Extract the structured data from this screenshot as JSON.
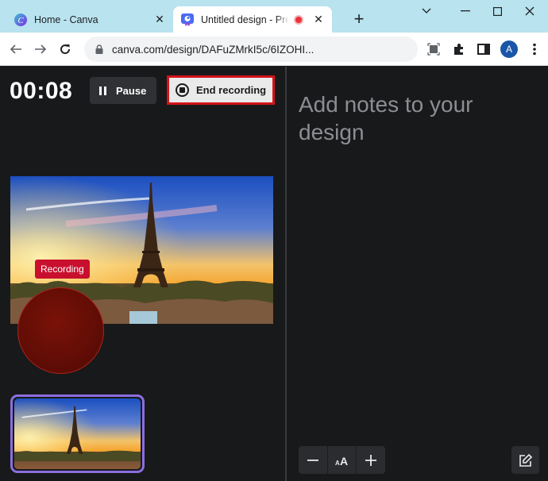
{
  "browser": {
    "tabs": [
      {
        "title": "Home - Canva",
        "favicon": "canva-logo-icon",
        "active": false
      },
      {
        "title": "Untitled design - Presenter",
        "favicon": "canva-present-icon",
        "active": true,
        "recording": true
      }
    ],
    "new_tab_label": "+",
    "url": "canva.com/design/DAFuZMrkI5c/6IZOHI...",
    "colors": {
      "tabstrip": "#b8e3ef",
      "avatar": "#1a56a8"
    },
    "profile_initial": "A"
  },
  "presenter": {
    "timer": "00:08",
    "pause_label": "Pause",
    "end_recording_label": "End recording",
    "recording_badge": "Recording",
    "colors": {
      "end_border": "#d3131a",
      "badge": "#c8102e",
      "thumb_border": "#8b6ee0"
    }
  },
  "notes": {
    "placeholder": "Add notes to your design",
    "controls": {
      "decrease": "decrease-font-icon",
      "font_size": "font-size-icon",
      "increase": "increase-font-icon",
      "edit": "edit-notes-icon"
    }
  }
}
